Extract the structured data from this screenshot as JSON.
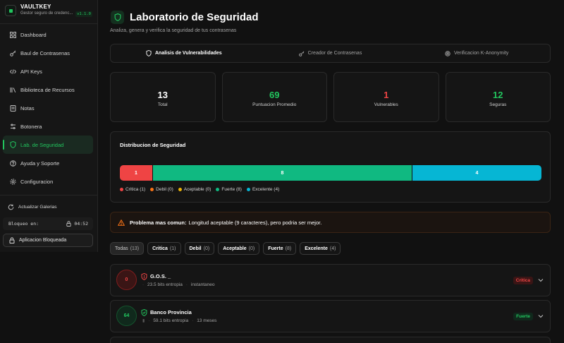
{
  "brand": {
    "title": "VAULTKEY",
    "subtitle": "Gestor seguro de credenc...",
    "version": "v1.1.0"
  },
  "sidebar": {
    "items": [
      {
        "label": "Dashboard",
        "icon": "grid-icon",
        "active": false
      },
      {
        "label": "Baul de Contrasenas",
        "icon": "key-icon",
        "active": false
      },
      {
        "label": "API Keys",
        "icon": "code-icon",
        "active": false
      },
      {
        "label": "Biblioteca de Recursos",
        "icon": "library-icon",
        "active": false
      },
      {
        "label": "Notas",
        "icon": "note-icon",
        "active": false
      },
      {
        "label": "Botonera",
        "icon": "sliders-icon",
        "active": false
      },
      {
        "label": "Lab. de Seguridad",
        "icon": "shield-icon",
        "active": true
      },
      {
        "label": "Ayuda y Soporte",
        "icon": "help-icon",
        "active": false
      },
      {
        "label": "Configuracion",
        "icon": "gear-icon",
        "active": false
      }
    ],
    "refresh_label": "Actualizar Galerias",
    "lock_label": "Bloqueo en:",
    "lock_time": "04:52",
    "locked_button": "Aplicacion Bloqueada"
  },
  "header": {
    "title": "Laboratorio de Seguridad",
    "subtitle": "Analiza, genera y verifica la seguridad de tus contrasenas"
  },
  "tabs": [
    {
      "label": "Analisis de Vulnerabilidades",
      "icon": "shield-icon",
      "active": true
    },
    {
      "label": "Creador de Contrasenas",
      "icon": "key-icon",
      "active": false
    },
    {
      "label": "Verificacion K-Anonymity",
      "icon": "fingerprint-icon",
      "active": false
    }
  ],
  "stats": [
    {
      "value": "13",
      "label": "Total",
      "color": "#ffffff"
    },
    {
      "value": "69",
      "label": "Puntuacion Promedio",
      "color": "#22c55e"
    },
    {
      "value": "1",
      "label": "Vulnerables",
      "color": "#ef4444"
    },
    {
      "value": "12",
      "label": "Seguras",
      "color": "#22c55e"
    }
  ],
  "distribution": {
    "title": "Distribucion de Seguridad",
    "segments": [
      {
        "label": "1",
        "value": 1,
        "color": "#ef4444"
      },
      {
        "label": "8",
        "value": 8,
        "color": "#10b981"
      },
      {
        "label": "4",
        "value": 4,
        "color": "#06b6d4"
      }
    ],
    "legend": [
      {
        "label": "Critica (1)",
        "color": "#ef4444"
      },
      {
        "label": "Debil (0)",
        "color": "#f97316"
      },
      {
        "label": "Aceptable (0)",
        "color": "#eab308"
      },
      {
        "label": "Fuerte (8)",
        "color": "#10b981"
      },
      {
        "label": "Excelente (4)",
        "color": "#06b6d4"
      }
    ]
  },
  "alert": {
    "strong": "Problema mas comun:",
    "text": "Longitud aceptable (9 caracteres), pero podria ser mejor."
  },
  "filters": [
    {
      "label": "Todas",
      "count": "(13)",
      "active": true
    },
    {
      "label": "Critica",
      "count": "(1)",
      "active": false
    },
    {
      "label": "Debil",
      "count": "(0)",
      "active": false
    },
    {
      "label": "Aceptable",
      "count": "(0)",
      "active": false
    },
    {
      "label": "Fuerte",
      "count": "(8)",
      "active": false
    },
    {
      "label": "Excelente",
      "count": "(4)",
      "active": false
    }
  ],
  "items": [
    {
      "score": "0",
      "name": "G.O.S. _",
      "entropy": "23.5 bits entropia",
      "time": "instantaneo",
      "badge": "Critica",
      "tone": "critical"
    },
    {
      "score": "64",
      "name": "Banco Provincia",
      "entropy": "59.1 bits entropia",
      "time": "13 meses",
      "badge": "Fuerte",
      "tone": "strong"
    }
  ],
  "colors": {
    "accent": "#22c55e",
    "critical": "#ef4444",
    "background": "#111111"
  }
}
